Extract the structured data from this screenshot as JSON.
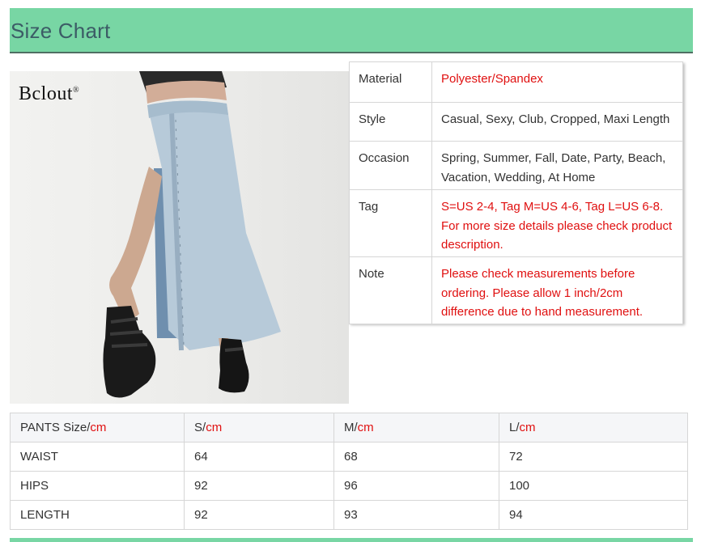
{
  "header": {
    "title": "Size Chart"
  },
  "photo": {
    "brand": "Bclout",
    "brand_mark": "®"
  },
  "attributes": [
    {
      "key": "Material",
      "value": "Polyester/Spandex",
      "highlight": true
    },
    {
      "key": "Style",
      "value": "Casual, Sexy, Club, Cropped, Maxi Length",
      "highlight": false
    },
    {
      "key": "Occasion",
      "value": "Spring, Summer, Fall, Date, Party, Beach, Vacation, Wedding, At Home",
      "highlight": false
    },
    {
      "key": "Tag",
      "value": "S=US 2-4, Tag M=US 4-6, Tag L=US 6-8. For more size details please check product description.",
      "highlight": true
    },
    {
      "key": "Note",
      "value": "Please check measurements before ordering. Please allow 1 inch/2cm difference due to hand measurement.",
      "highlight": true
    }
  ],
  "size_table": {
    "headers": [
      {
        "label": "PANTS Size/",
        "unit": "cm"
      },
      {
        "label": "S/",
        "unit": "cm"
      },
      {
        "label": "M/",
        "unit": "cm"
      },
      {
        "label": "L/",
        "unit": "cm"
      }
    ],
    "rows": [
      {
        "name": "WAIST",
        "values": [
          "64",
          "68",
          "72"
        ]
      },
      {
        "name": "HIPS",
        "values": [
          "92",
          "96",
          "100"
        ]
      },
      {
        "name": "LENGTH",
        "values": [
          "92",
          "93",
          "94"
        ]
      }
    ]
  },
  "colors": {
    "accent": "#78d6a4",
    "highlight_text": "#e01010",
    "title_text": "#3c5c66"
  }
}
